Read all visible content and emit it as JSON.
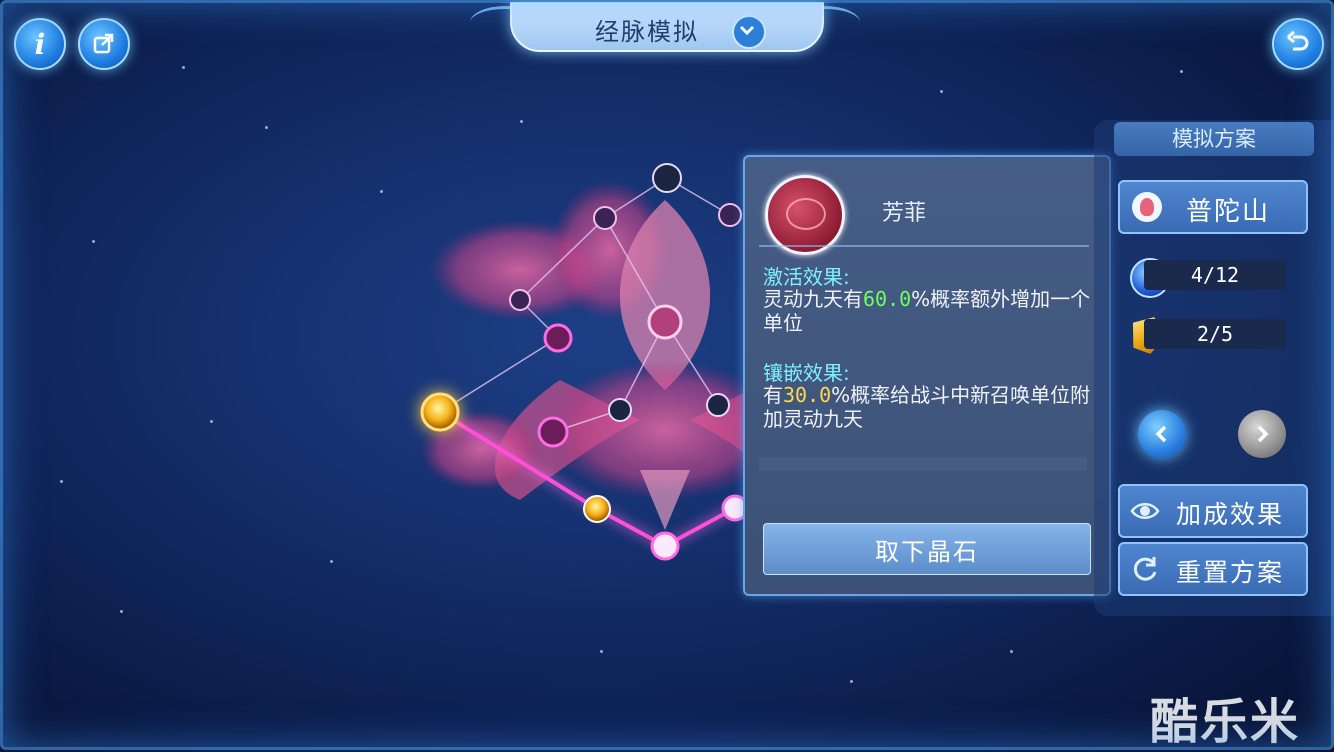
{
  "header": {
    "title": "经脉模拟"
  },
  "gem_panel": {
    "gem_name": "芳菲",
    "activation": {
      "title": "激活效果:",
      "text_before": "灵动九天有",
      "value": "60.0",
      "text_after": "%概率额外增加一个单位"
    },
    "inlay": {
      "title": "镶嵌效果:",
      "text_before": "有",
      "value": "30.0",
      "text_after": "%概率给战斗中新召唤单位附加灵动九天"
    },
    "remove_button": "取下晶石"
  },
  "side_panel": {
    "title": "模拟方案",
    "school_button": "普陀山",
    "points_counter": "4/12",
    "crystal_counter": "2/5",
    "bonus_button": "加成效果",
    "reset_button": "重置方案"
  },
  "watermark": "酷乐米",
  "colors": {
    "accent_blue": "#2d7fd6",
    "highlight_green": "#6dff5e",
    "highlight_yellow": "#ffd84a",
    "section_title_cyan": "#7ff0ff",
    "meridian_pink": "#ff4fd8"
  },
  "icons": {
    "info": "info-icon",
    "share": "share-icon",
    "back": "return-icon",
    "dropdown": "chevron-down-icon",
    "prev": "chevron-left-icon",
    "next": "chevron-right-icon",
    "bonus": "eye-icon",
    "reset": "refresh-icon"
  }
}
